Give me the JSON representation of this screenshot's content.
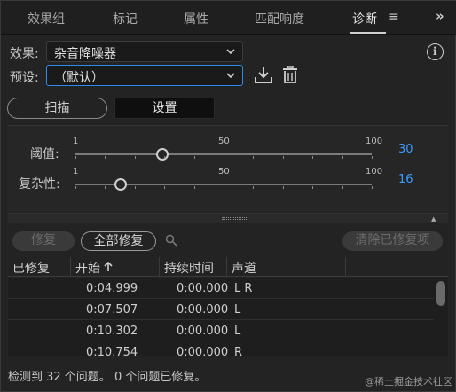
{
  "tabs": [
    {
      "label": "效果组"
    },
    {
      "label": "标记"
    },
    {
      "label": "属性"
    },
    {
      "label": "匹配响度"
    },
    {
      "label": "诊断"
    }
  ],
  "effect": {
    "label": "效果:",
    "value": "杂音降噪器"
  },
  "preset": {
    "label": "预设:",
    "value": "（默认）"
  },
  "mode": {
    "scan": "扫描",
    "settings": "设置"
  },
  "threshold": {
    "label": "阈值:",
    "value": "30",
    "min": "1",
    "mid": "50",
    "max": "100",
    "level": 30
  },
  "complexity": {
    "label": "复杂性:",
    "value": "16",
    "min": "1",
    "mid": "50",
    "max": "100",
    "level": 16
  },
  "actions": {
    "repair": "修复",
    "repair_all": "全部修复",
    "clear_repaired": "清除已修复项"
  },
  "table": {
    "headers": [
      "已修复",
      "开始",
      "持续时间",
      "声道"
    ],
    "rows": [
      {
        "start": "0:04.999",
        "duration": "0:00.000",
        "channel": "L R"
      },
      {
        "start": "0:07.507",
        "duration": "0:00.000",
        "channel": "L"
      },
      {
        "start": "0:10.302",
        "duration": "0:00.000",
        "channel": "L"
      },
      {
        "start": "0:10.754",
        "duration": "0:00.000",
        "channel": "R"
      }
    ]
  },
  "status": "检测到 32 个问题。 0 个问题已修复。",
  "watermark": "@稀土掘金技术社区",
  "colors": {
    "accent": "#2d8ceb",
    "value_blue": "#3d9bff",
    "background": "#232323"
  }
}
